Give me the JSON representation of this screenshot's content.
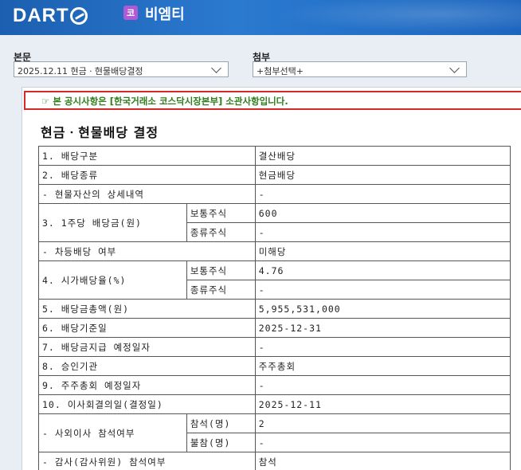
{
  "header": {
    "logo_text": "DART",
    "corp_badge": "코",
    "corp_name": "비엠티"
  },
  "selectors": {
    "main": {
      "label": "본문",
      "value": "2025.12.11  현금ㆍ현물배당결정"
    },
    "attach": {
      "label": "첨부",
      "value": "+첨부선택+"
    }
  },
  "notice": "☞ 본 공시사항은 [한국거래소 코스닥시장본부] 소관사항입니다.",
  "doc_title": "현금ㆍ현물배당 결정",
  "table": {
    "r1": {
      "label": "1. 배당구분",
      "value": "결산배당"
    },
    "r2": {
      "label": "2. 배당종류",
      "value": "현금배당"
    },
    "r3": {
      "label": "- 현물자산의 상세내역",
      "value": "-"
    },
    "r4": {
      "label": "3. 1주당 배당금(원)",
      "sub1": "보통주식",
      "val1": "600",
      "sub2": "종류주식",
      "val2": "-"
    },
    "r5": {
      "label": "- 차등배당 여부",
      "value": "미해당"
    },
    "r6": {
      "label": "4. 시가배당율(%)",
      "sub1": "보통주식",
      "val1": "4.76",
      "sub2": "종류주식",
      "val2": "-"
    },
    "r7": {
      "label": "5. 배당금총액(원)",
      "value": "5,955,531,000"
    },
    "r8": {
      "label": "6. 배당기준일",
      "value": "2025-12-31"
    },
    "r9": {
      "label": "7. 배당금지급 예정일자",
      "value": "-"
    },
    "r10": {
      "label": "8. 승인기관",
      "value": "주주총회"
    },
    "r11": {
      "label": "9. 주주총회 예정일자",
      "value": "-"
    },
    "r12": {
      "label": "10. 이사회결의일(결정일)",
      "value": "2025-12-11"
    },
    "r13": {
      "label": "- 사외이사 참석여부",
      "sub1": "참석(명)",
      "val1": "2",
      "sub2": "불참(명)",
      "val2": "-"
    },
    "r14": {
      "label": "- 감사(감사위원) 참석여부",
      "value": "참석"
    }
  },
  "colors": {
    "header_blue": "#1c5fb0",
    "notice_border": "#d42a2a",
    "notice_text": "#2e7d1a",
    "badge": "#b05ad8"
  }
}
